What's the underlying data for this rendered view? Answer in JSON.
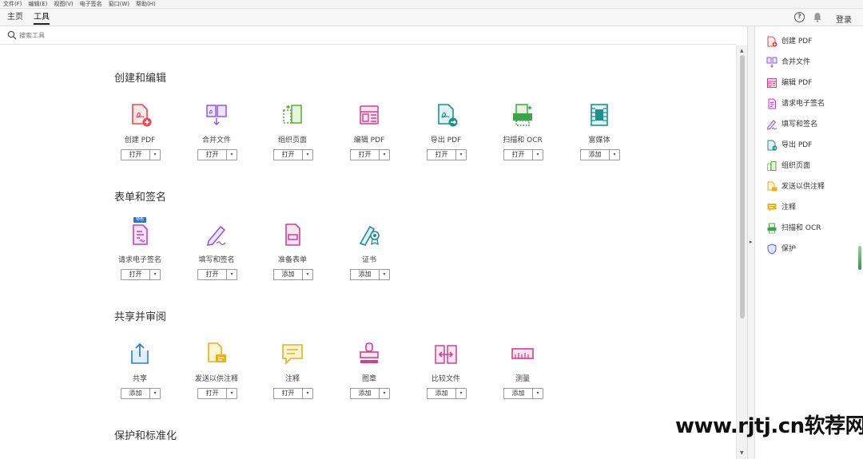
{
  "menubar": [
    "文件(F)",
    "编辑(E)",
    "视图(V)",
    "电子签名",
    "窗口(W)",
    "帮助(H)"
  ],
  "nav": {
    "home": "主页",
    "tools": "工具",
    "login": "登录"
  },
  "search": {
    "placeholder": "搜索工具"
  },
  "sections": [
    {
      "title": "创建和编辑",
      "tools": [
        {
          "label": "创建 PDF",
          "action": "打开"
        },
        {
          "label": "合并文件",
          "action": "打开"
        },
        {
          "label": "组织页面",
          "action": "打开"
        },
        {
          "label": "编辑 PDF",
          "action": "打开"
        },
        {
          "label": "导出 PDF",
          "action": "打开"
        },
        {
          "label": "扫描和 OCR",
          "action": "打开"
        },
        {
          "label": "富媒体",
          "action": "添加"
        }
      ]
    },
    {
      "title": "表单和签名",
      "badge": "特色",
      "tools": [
        {
          "label": "请求电子签名",
          "action": "打开"
        },
        {
          "label": "填写和签名",
          "action": "打开"
        },
        {
          "label": "准备表单",
          "action": "添加"
        },
        {
          "label": "证书",
          "action": "添加"
        }
      ]
    },
    {
      "title": "共享并审阅",
      "tools": [
        {
          "label": "共享",
          "action": "添加"
        },
        {
          "label": "发送以供注释",
          "action": "打开"
        },
        {
          "label": "注释",
          "action": "打开"
        },
        {
          "label": "图章",
          "action": "添加"
        },
        {
          "label": "比较文件",
          "action": "添加"
        },
        {
          "label": "测量",
          "action": "添加"
        }
      ]
    },
    {
      "title": "保护和标准化",
      "tools": []
    }
  ],
  "right_panel": [
    "创建 PDF",
    "合并文件",
    "编辑 PDF",
    "请求电子签名",
    "填写和签名",
    "导出 PDF",
    "组织页面",
    "发送以供注释",
    "注释",
    "扫描和 OCR",
    "保护"
  ],
  "watermark": "www.rjtj.cn软荐网",
  "colors": {
    "red": "#e8484e",
    "purple": "#8a5be8",
    "green": "#5aaa3a",
    "pink": "#d63f8c",
    "teal": "#1e8f8f",
    "blue": "#2d7fd6",
    "yellow": "#e6b21c"
  }
}
